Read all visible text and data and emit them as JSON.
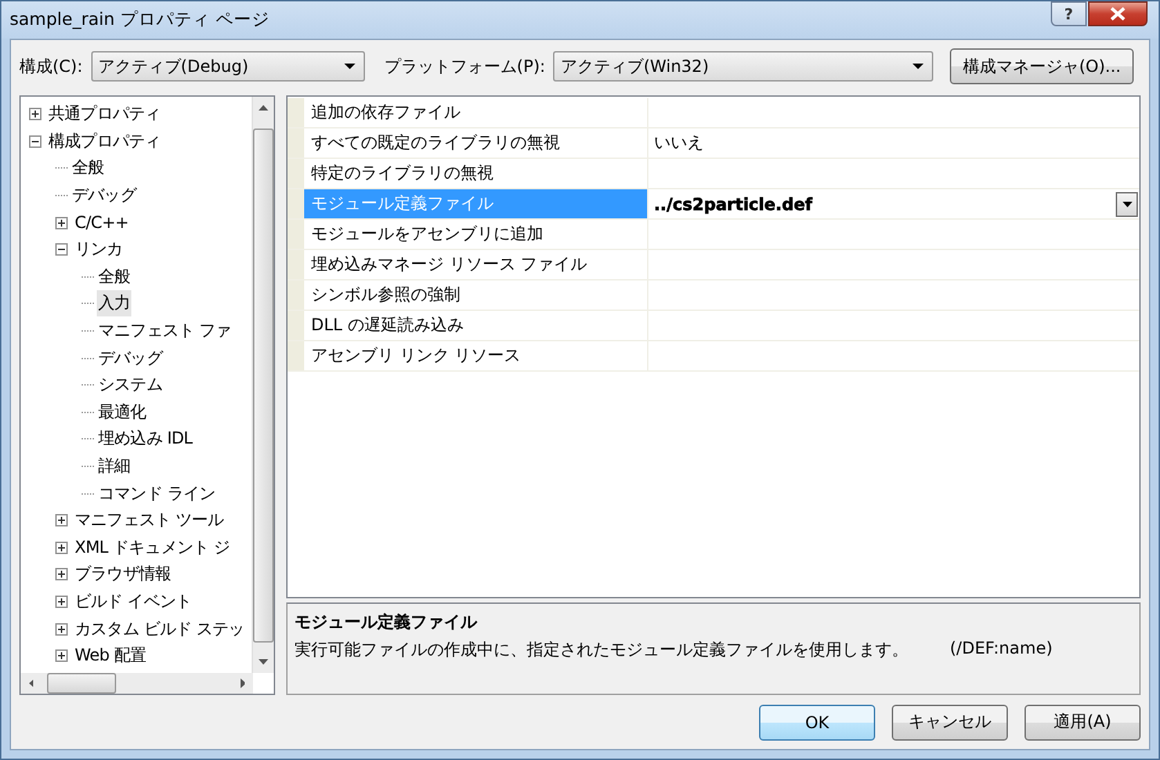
{
  "window": {
    "title": "sample_rain プロパティ ページ",
    "help_button": "?"
  },
  "toolbar": {
    "config_label": "構成(C):",
    "config_value": "アクティブ(Debug)",
    "platform_label": "プラットフォーム(P):",
    "platform_value": "アクティブ(Win32)",
    "manager_button": "構成マネージャ(O)..."
  },
  "tree": [
    {
      "label": "共通プロパティ",
      "expanded": false,
      "selected": false
    },
    {
      "label": "構成プロパティ",
      "expanded": true,
      "selected": false,
      "children": [
        {
          "label": "全般",
          "selected": false
        },
        {
          "label": "デバッグ",
          "selected": false
        },
        {
          "label": "C/C++",
          "expanded": false,
          "selected": false
        },
        {
          "label": "リンカ",
          "expanded": true,
          "selected": false,
          "children": [
            {
              "label": "全般",
              "selected": false
            },
            {
              "label": "入力",
              "selected": true
            },
            {
              "label": "マニフェスト ファ",
              "selected": false
            },
            {
              "label": "デバッグ",
              "selected": false
            },
            {
              "label": "システム",
              "selected": false
            },
            {
              "label": "最適化",
              "selected": false
            },
            {
              "label": "埋め込み IDL",
              "selected": false
            },
            {
              "label": "詳細",
              "selected": false
            },
            {
              "label": "コマンド ライン",
              "selected": false
            }
          ]
        },
        {
          "label": "マニフェスト ツール",
          "expanded": false,
          "selected": false
        },
        {
          "label": "XML ドキュメント ジ",
          "expanded": false,
          "selected": false
        },
        {
          "label": "ブラウザ情報",
          "expanded": false,
          "selected": false
        },
        {
          "label": "ビルド イベント",
          "expanded": false,
          "selected": false
        },
        {
          "label": "カスタム ビルド ステッ",
          "expanded": false,
          "selected": false
        },
        {
          "label": "Web 配置",
          "expanded": false,
          "selected": false
        }
      ]
    }
  ],
  "properties": [
    {
      "name": "追加の依存ファイル",
      "selected": false
    },
    {
      "name": "すべての既定のライブラリの無視",
      "value": "いいえ",
      "selected": false,
      "modified": false
    },
    {
      "name": "特定のライブラリの無視",
      "selected": false
    },
    {
      "name": "モジュール定義ファイル",
      "value": "../cs2particle.def",
      "selected": true,
      "modified": true
    },
    {
      "name": "モジュールをアセンブリに追加",
      "selected": false
    },
    {
      "name": "埋め込みマネージ リソース ファイル",
      "selected": false
    },
    {
      "name": "シンボル参照の強制",
      "selected": false
    },
    {
      "name": "DLL の遅延読み込み",
      "selected": false
    },
    {
      "name": "アセンブリ リンク リソース",
      "selected": false
    }
  ],
  "description": {
    "title": "モジュール定義ファイル",
    "text": "実行可能ファイルの作成中に、指定されたモジュール定義ファイルを使用します。",
    "switch": "(/DEF:name)"
  },
  "buttons": [
    {
      "label": "OK",
      "default": true
    },
    {
      "label": "キャンセル",
      "default": false
    },
    {
      "label": "適用(A)",
      "default": false
    }
  ]
}
